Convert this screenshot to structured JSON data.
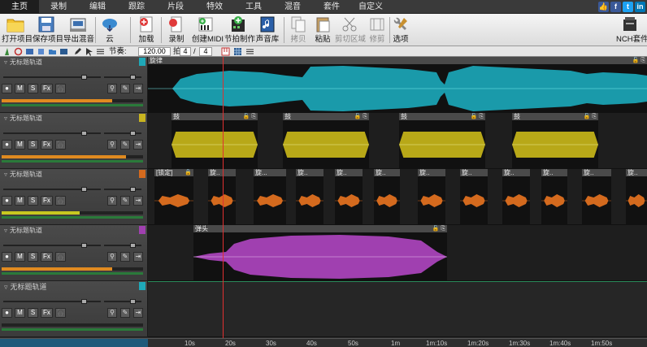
{
  "menu": [
    "主页",
    "录制",
    "编辑",
    "跟踪",
    "片段",
    "特效",
    "工具",
    "混音",
    "套件",
    "自定义"
  ],
  "social": [
    {
      "name": "like",
      "glyph": "👍",
      "color": "#3b5998"
    },
    {
      "name": "facebook",
      "glyph": "f",
      "color": "#3b5998"
    },
    {
      "name": "twitter",
      "glyph": "t",
      "color": "#1da1f2"
    },
    {
      "name": "linkedin",
      "glyph": "in",
      "color": "#0077b5"
    }
  ],
  "toolbar": {
    "open": "打开项目",
    "save": "保存项目",
    "export": "导出混音",
    "cloud": "云",
    "add": "加载",
    "record": "录制",
    "create_midi": "创建MIDI",
    "beat": "节拍制作",
    "sound_lib": "声音库",
    "copy": "拷贝",
    "paste": "粘贴",
    "cut_region": "剪切区域",
    "trim": "修剪",
    "options": "选项",
    "nch": "NCH套件"
  },
  "toolbar2": {
    "tempo_label": "节奏:",
    "tempo_value": "120.00",
    "beat_label": "拍号:",
    "beat_num": "4",
    "beat_sep": "/",
    "beat_den": "4"
  },
  "colors": {
    "teal": "#1a9aaa",
    "yellow": "#c8b420",
    "orange": "#d46a1e",
    "purple": "#a040b0",
    "teal2": "#1fa8b8"
  },
  "tracks": [
    {
      "name": "无标题轨道",
      "color": "#1fa8b8",
      "meter": 0.78,
      "meter_color": "#e08a20"
    },
    {
      "name": "无标题轨道",
      "color": "#c8b420",
      "meter": 0.88,
      "meter_color": "#e08a20"
    },
    {
      "name": "无标题轨道",
      "color": "#d46a1e",
      "meter": 0.55,
      "meter_color": "#c8c820"
    },
    {
      "name": "无标题轨道",
      "color": "#a040b0",
      "meter": 0.78,
      "meter_color": "#e08a20"
    },
    {
      "name": "无标题轨道",
      "color": "#1fa8b8",
      "meter": 0,
      "meter_color": "#e08a20"
    }
  ],
  "track_buttons": {
    "m": "M",
    "s": "S",
    "fx": "Fx"
  },
  "clips": {
    "melody": "旋律",
    "drum": "鼓",
    "locked": "[锁定]",
    "rotate_short": "旋..",
    "rotate_short2": "旋...",
    "pluck": "弹头"
  },
  "ruler": [
    "10s",
    "20s",
    "30s",
    "40s",
    "50s",
    "1m",
    "1m:10s",
    "1m:20s",
    "1m:30s",
    "1m:40s",
    "1m:50s"
  ]
}
